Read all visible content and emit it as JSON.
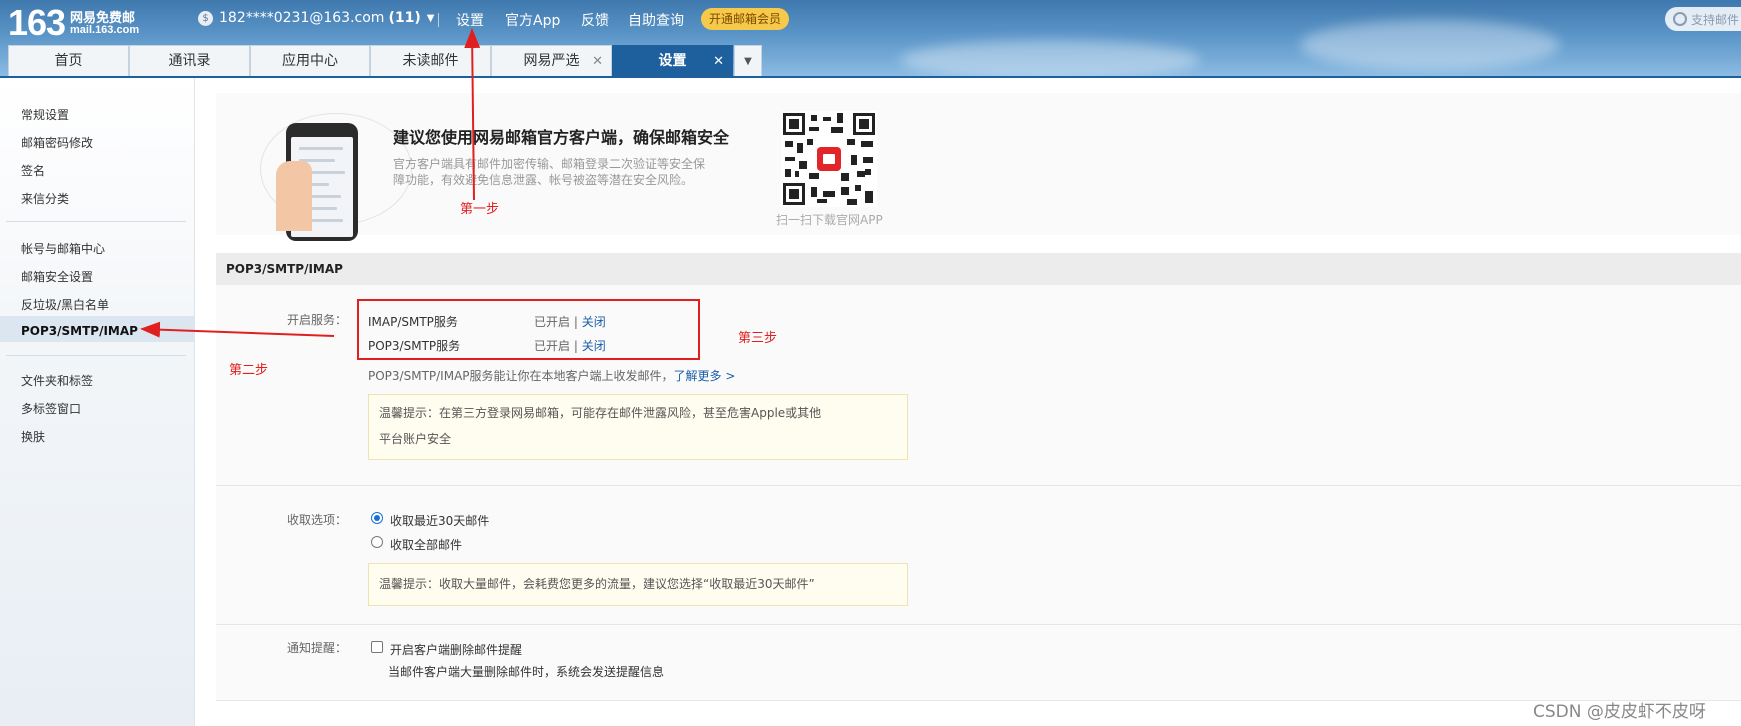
{
  "header": {
    "logo_number": "163",
    "logo_cn": "网易免费邮",
    "logo_domain": "mail.163.com",
    "account_email": "182****0231@163.com",
    "unread_count": "(11)",
    "links": [
      "设置",
      "官方App",
      "反馈",
      "自助查询"
    ],
    "vip_button": "开通邮箱会员",
    "search_placeholder": "支持邮件"
  },
  "tabs": [
    {
      "label": "首页"
    },
    {
      "label": "通讯录"
    },
    {
      "label": "应用中心"
    },
    {
      "label": "未读邮件"
    },
    {
      "label": "网易严选",
      "closable": true
    },
    {
      "label": "设置",
      "closable": true,
      "active": true
    }
  ],
  "sidebar": {
    "groups": [
      [
        "常规设置",
        "邮箱密码修改",
        "签名",
        "来信分类"
      ],
      [
        "帐号与邮箱中心",
        "邮箱安全设置",
        "反垃圾/黑白名单",
        "POP3/SMTP/IMAP"
      ],
      [
        "文件夹和标签",
        "多标签窗口",
        "换肤"
      ]
    ],
    "selected": "POP3/SMTP/IMAP"
  },
  "promo": {
    "title": "建议您使用网易邮箱官方客户端，确保邮箱安全",
    "desc": "官方客户端具有邮件加密传输、邮箱登录二次验证等安全保障功能，有效避免信息泄露、帐号被盗等潜在安全风险。",
    "qr_caption": "扫一扫下载官网APP"
  },
  "section_title": "POP3/SMTP/IMAP",
  "services": {
    "label": "开启服务：",
    "rows": [
      {
        "name": "IMAP/SMTP服务",
        "status": "已开启",
        "separator": "|",
        "action": "关闭"
      },
      {
        "name": "POP3/SMTP服务",
        "status": "已开启",
        "separator": "|",
        "action": "关闭"
      }
    ],
    "info": "POP3/SMTP/IMAP服务能让你在本地客户端上收发邮件，",
    "learn_more": "了解更多 >",
    "tip_line1": "温馨提示：在第三方登录网易邮箱，可能存在邮件泄露风险，甚至危害Apple或其他",
    "tip_line2": "平台账户安全"
  },
  "receive": {
    "label": "收取选项：",
    "options": [
      "收取最近30天邮件",
      "收取全部邮件"
    ],
    "selected": 0,
    "tip": "温馨提示：收取大量邮件，会耗费您更多的流量，建议您选择“收取最近30天邮件”"
  },
  "notify": {
    "label": "通知提醒：",
    "checkbox_label": "开启客户端删除邮件提醒",
    "checked": false,
    "desc": "当邮件客户端大量删除邮件时，系统会发送提醒信息"
  },
  "annotations": {
    "step1": "第一步",
    "step2": "第二步",
    "step3": "第三步",
    "color": "#e02020"
  },
  "watermark": "CSDN @皮皮虾不皮呀",
  "colors": {
    "accent": "#1e5f9e",
    "link": "#1a5ea8",
    "vip": "#f6c94b"
  }
}
